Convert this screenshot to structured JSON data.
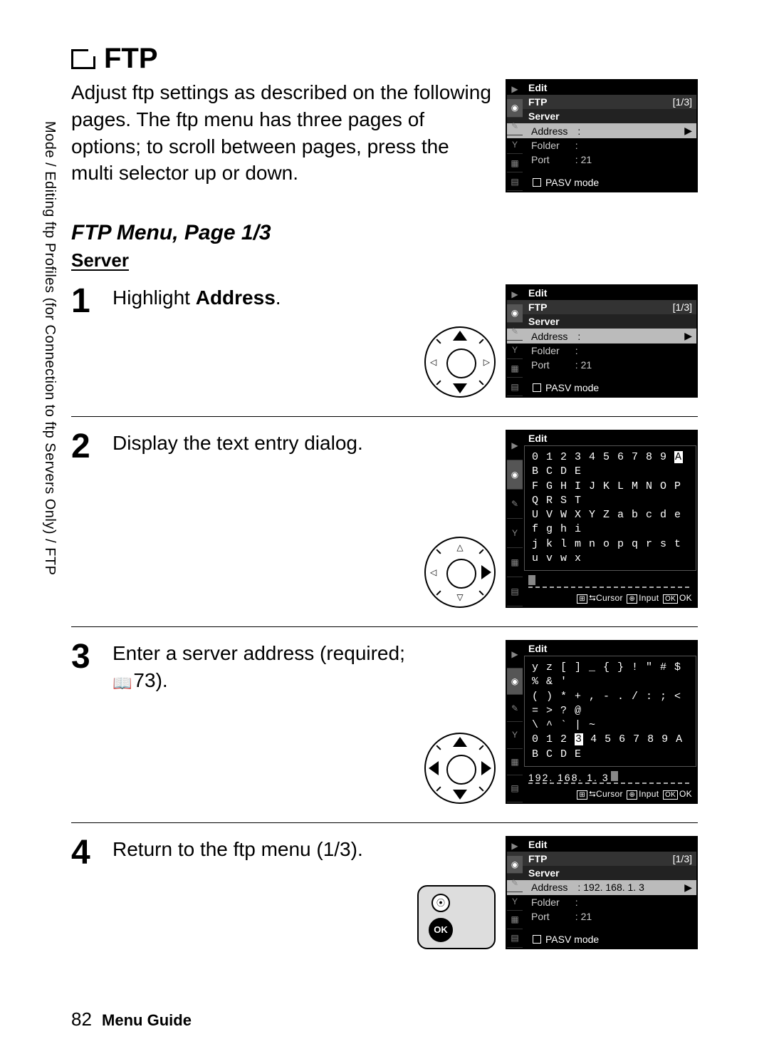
{
  "side_label": "Mode / Editing ftp Profiles (for Connection to ftp Servers Only) / FTP",
  "title": "FTP",
  "intro": "Adjust ftp settings as described on the following pages.  The ftp menu has three pages of options; to scroll between pages, press the multi selector up or down.",
  "section_heading": "FTP Menu, Page 1/3",
  "subsection": "Server",
  "steps": {
    "s1": {
      "num": "1",
      "pre": "Highlight ",
      "bold": "Address",
      "post": "."
    },
    "s2": {
      "num": "2",
      "text": "Display the text entry dialog."
    },
    "s3": {
      "num": "3",
      "text_a": "Enter a server address (required; ",
      "ref": "73",
      "text_b": ")."
    },
    "s4": {
      "num": "4",
      "text": "Return to the ftp menu (1/3)."
    }
  },
  "lcd_common": {
    "edit": "Edit",
    "ftp": "FTP",
    "page": "[1/3]",
    "server": "Server",
    "address": "Address",
    "folder": "Folder",
    "port": "Port",
    "port_val": "21",
    "pasv": "PASV mode",
    "sep": ":"
  },
  "lcd_text": {
    "row1": "0 1 2 3 4 5 6 7 8 9",
    "row1_hl": "A",
    "row1b": "B C D E",
    "row2": "F G H I J K L M N O P Q R S T",
    "row3": "U V W X Y Z a b c d e f g h i",
    "row4": "j k l m n o p q r s t u v w x",
    "hint_cursor": "Cursor",
    "hint_input": "Input",
    "hint_ok": "OK"
  },
  "lcd_text2": {
    "row1": "y z   [ ] _ { } ! \" # $ % & '",
    "row2": "( ) * + , - . / : ; < = > ? @",
    "row3": "\\ ^ ` | ~",
    "row4a": "0 1 2",
    "row4_hl": "3",
    "row4b": "4 5 6 7 8 9 A B C D E",
    "entered": "192. 168. 1. 3"
  },
  "lcd4_address_val": "192. 168. 1. 3",
  "footer": {
    "page": "82",
    "guide": "Menu Guide"
  }
}
